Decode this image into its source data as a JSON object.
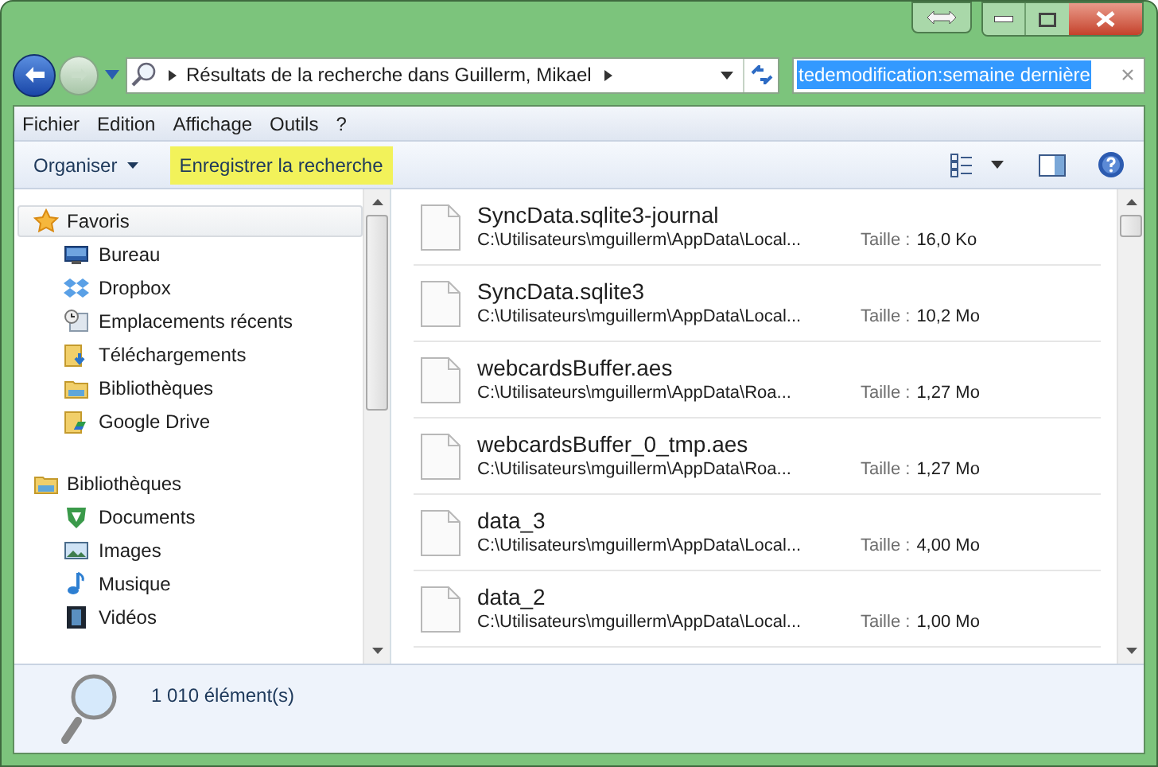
{
  "address": {
    "path": "Résultats de la recherche dans Guillerm, Mikael"
  },
  "search": {
    "value": "tedemodification:semaine dernière",
    "text_selected": true
  },
  "menu": [
    "Fichier",
    "Edition",
    "Affichage",
    "Outils",
    "?"
  ],
  "toolbar": {
    "organize": "Organiser",
    "save_search": {
      "label": "Enregistrer la recherche",
      "highlighted": true
    }
  },
  "sidebar": {
    "groups": [
      {
        "label": "Favoris",
        "kind": "star",
        "selected": true,
        "items": [
          {
            "label": "Bureau",
            "kind": "desktop"
          },
          {
            "label": "Dropbox",
            "kind": "dropbox"
          },
          {
            "label": "Emplacements récents",
            "kind": "recent"
          },
          {
            "label": "Téléchargements",
            "kind": "download"
          },
          {
            "label": "Bibliothèques",
            "kind": "library"
          },
          {
            "label": "Google Drive",
            "kind": "drive"
          }
        ]
      },
      {
        "label": "Bibliothèques",
        "kind": "library",
        "selected": false,
        "items": [
          {
            "label": "Documents",
            "kind": "documents"
          },
          {
            "label": "Images",
            "kind": "images"
          },
          {
            "label": "Musique",
            "kind": "music"
          },
          {
            "label": "Vidéos",
            "kind": "videos"
          }
        ]
      }
    ]
  },
  "files": [
    {
      "name": "SyncData.sqlite3-journal",
      "path": "C:\\Utilisateurs\\mguillerm\\AppData\\Local...",
      "size_label": "Taille :",
      "size": "16,0 Ko"
    },
    {
      "name": "SyncData.sqlite3",
      "path": "C:\\Utilisateurs\\mguillerm\\AppData\\Local...",
      "size_label": "Taille :",
      "size": "10,2 Mo"
    },
    {
      "name": "webcardsBuffer.aes",
      "path": "C:\\Utilisateurs\\mguillerm\\AppData\\Roa...",
      "size_label": "Taille :",
      "size": "1,27 Mo"
    },
    {
      "name": "webcardsBuffer_0_tmp.aes",
      "path": "C:\\Utilisateurs\\mguillerm\\AppData\\Roa...",
      "size_label": "Taille :",
      "size": "1,27 Mo"
    },
    {
      "name": "data_3",
      "path": "C:\\Utilisateurs\\mguillerm\\AppData\\Local...",
      "size_label": "Taille :",
      "size": "4,00 Mo"
    },
    {
      "name": "data_2",
      "path": "C:\\Utilisateurs\\mguillerm\\AppData\\Local...",
      "size_label": "Taille :",
      "size": "1,00 Mo"
    }
  ],
  "status": {
    "count": "1 010 élément(s)"
  }
}
